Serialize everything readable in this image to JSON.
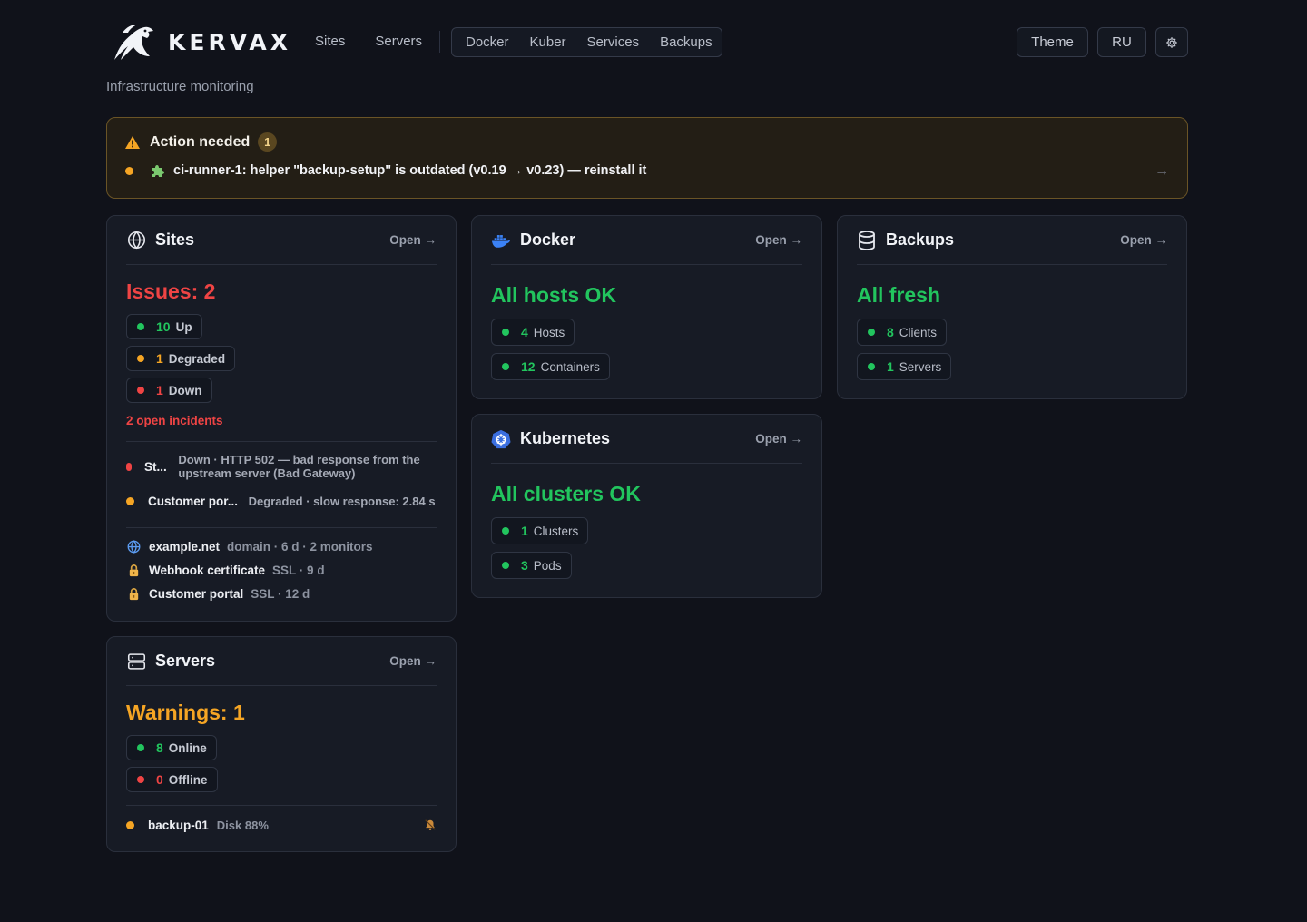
{
  "brand": {
    "name": "KERVAX",
    "subtitle": "Infrastructure monitoring"
  },
  "nav": {
    "primary": [
      "Sites",
      "Servers"
    ],
    "group": [
      "Docker",
      "Kuber",
      "Services",
      "Backups"
    ]
  },
  "top_buttons": {
    "theme": "Theme",
    "lang": "RU",
    "settings_icon": "gear-icon"
  },
  "alert": {
    "title": "Action needed",
    "count": "1",
    "message": "ci-runner-1: helper \"backup-setup\" is outdated (v0.19 → v0.23) — reinstall it",
    "arrow": "→",
    "colors": {
      "accent": "#f5a524",
      "border": "#6a5426"
    }
  },
  "sites": {
    "title": "Sites",
    "open": "Open →",
    "status": "Issues: 2",
    "pills": [
      {
        "num": "10",
        "label": "Up"
      },
      {
        "num": "1",
        "label": "Degraded"
      },
      {
        "num": "1",
        "label": "Down"
      }
    ],
    "incidents_label": "2 open incidents",
    "incidents": [
      {
        "name": "St...",
        "desc": "Down · HTTP 502 — bad response from the upstream server (Bad Gateway)"
      },
      {
        "name": "Customer por...",
        "desc": "Degraded · slow response: 2.84 s"
      }
    ],
    "domains": [
      {
        "name": "example.net",
        "meta": "domain · 6 d · 2 monitors",
        "icon": "globe-icon"
      },
      {
        "name": "Webhook certificate",
        "meta": "SSL · 9 d",
        "icon": "lock-icon"
      },
      {
        "name": "Customer portal",
        "meta": "SSL · 12 d",
        "icon": "lock-icon"
      }
    ]
  },
  "servers": {
    "title": "Servers",
    "open": "Open →",
    "status": "Warnings: 1",
    "pills": [
      {
        "num": "8",
        "label": "Online"
      },
      {
        "num": "0",
        "label": "Offline"
      }
    ],
    "warning": {
      "name": "backup-01",
      "meta": "Disk 88%",
      "icon": "bell-muted-icon"
    }
  },
  "docker": {
    "title": "Docker",
    "open": "Open →",
    "status": "All hosts OK",
    "pills": [
      {
        "num": "4",
        "label": "Hosts"
      },
      {
        "num": "12",
        "label": "Containers"
      }
    ]
  },
  "kubernetes": {
    "title": "Kubernetes",
    "open": "Open →",
    "status": "All clusters OK",
    "pills": [
      {
        "num": "1",
        "label": "Clusters"
      },
      {
        "num": "3",
        "label": "Pods"
      }
    ]
  },
  "backups": {
    "title": "Backups",
    "open": "Open →",
    "status": "All fresh",
    "pills": [
      {
        "num": "8",
        "label": "Clients"
      },
      {
        "num": "1",
        "label": "Servers"
      }
    ]
  },
  "colors": {
    "ok": "#22c55e",
    "warn": "#f5a524",
    "error": "#ef4444",
    "bg": "#10121a",
    "card": "#171b25"
  }
}
